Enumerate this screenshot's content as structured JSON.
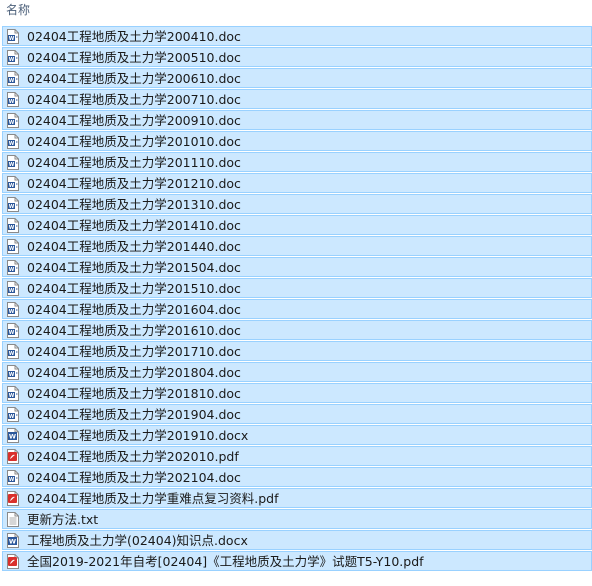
{
  "header": {
    "name_label": "名称"
  },
  "files": [
    {
      "name": "02404工程地质及土力学200410.doc",
      "icon": "word-doc-icon"
    },
    {
      "name": "02404工程地质及土力学200510.doc",
      "icon": "word-doc-icon"
    },
    {
      "name": "02404工程地质及土力学200610.doc",
      "icon": "word-doc-icon"
    },
    {
      "name": "02404工程地质及土力学200710.doc",
      "icon": "word-doc-icon"
    },
    {
      "name": "02404工程地质及土力学200910.doc",
      "icon": "word-doc-icon"
    },
    {
      "name": "02404工程地质及土力学201010.doc",
      "icon": "word-doc-icon"
    },
    {
      "name": "02404工程地质及土力学201110.doc",
      "icon": "word-doc-icon"
    },
    {
      "name": "02404工程地质及土力学201210.doc",
      "icon": "word-doc-icon"
    },
    {
      "name": "02404工程地质及土力学201310.doc",
      "icon": "word-doc-icon"
    },
    {
      "name": "02404工程地质及土力学201410.doc",
      "icon": "word-doc-icon"
    },
    {
      "name": "02404工程地质及土力学201440.doc",
      "icon": "word-doc-icon"
    },
    {
      "name": "02404工程地质及土力学201504.doc",
      "icon": "word-doc-icon"
    },
    {
      "name": "02404工程地质及土力学201510.doc",
      "icon": "word-doc-icon"
    },
    {
      "name": "02404工程地质及土力学201604.doc",
      "icon": "word-doc-icon"
    },
    {
      "name": "02404工程地质及土力学201610.doc",
      "icon": "word-doc-icon"
    },
    {
      "name": "02404工程地质及土力学201710.doc",
      "icon": "word-doc-icon"
    },
    {
      "name": "02404工程地质及土力学201804.doc",
      "icon": "word-doc-icon"
    },
    {
      "name": "02404工程地质及土力学201810.doc",
      "icon": "word-doc-icon"
    },
    {
      "name": "02404工程地质及土力学201904.doc",
      "icon": "word-doc-icon"
    },
    {
      "name": "02404工程地质及土力学201910.docx",
      "icon": "word-docx-icon"
    },
    {
      "name": "02404工程地质及土力学202010.pdf",
      "icon": "pdf-icon"
    },
    {
      "name": "02404工程地质及土力学202104.doc",
      "icon": "word-doc-icon"
    },
    {
      "name": "02404工程地质及土力学重难点复习资料.pdf",
      "icon": "pdf-icon"
    },
    {
      "name": "更新方法.txt",
      "icon": "text-file-icon"
    },
    {
      "name": "工程地质及土力学(02404)知识点.docx",
      "icon": "word-docx-icon"
    },
    {
      "name": "全国2019-2021年自考[02404]《工程地质及土力学》试题T5-Y10.pdf",
      "icon": "pdf-icon"
    }
  ],
  "colors": {
    "selected_bg": "#cce8ff",
    "selected_border": "#99d1ff",
    "header_text": "#4c607a",
    "word_blue": "#2b579a",
    "pdf_red": "#d9302c"
  }
}
